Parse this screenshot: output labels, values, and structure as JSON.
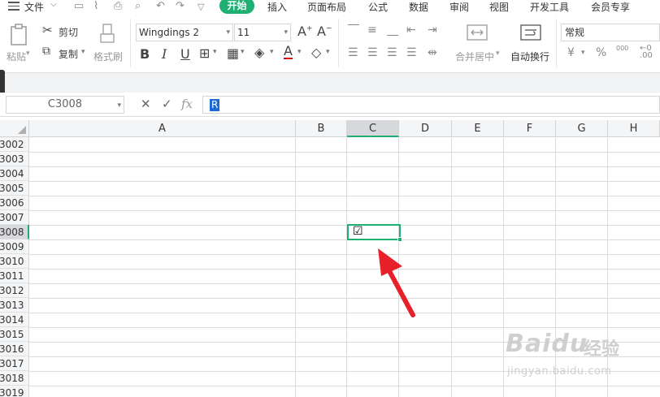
{
  "menu": {
    "file_label": "文件",
    "tabs": [
      "开始",
      "插入",
      "页面布局",
      "公式",
      "数据",
      "审阅",
      "视图",
      "开发工具",
      "会员专享"
    ],
    "active_tab": "开始"
  },
  "ribbon": {
    "paste_label": "粘贴",
    "cut_label": "剪切",
    "copy_label": "复制",
    "format_painter_label": "格式刷",
    "font_name": "Wingdings 2",
    "font_size": "11",
    "bold_label": "B",
    "italic_label": "I",
    "underline_label": "U",
    "font_color_label": "A",
    "merge_center_label": "合并居中",
    "wrap_text_label": "自动换行",
    "number_format": "常规",
    "currency_symbol": "¥",
    "percent_symbol": "%",
    "thousands_label": "000"
  },
  "formula_bar": {
    "name_box": "C3008",
    "cancel_symbol": "✕",
    "confirm_symbol": "✓",
    "fx_label": "fx",
    "content": "R"
  },
  "grid": {
    "columns": [
      "A",
      "B",
      "C",
      "D",
      "E",
      "F",
      "G",
      "H"
    ],
    "selected_column": "C",
    "rows": [
      "3002",
      "3003",
      "3004",
      "3005",
      "3006",
      "3007",
      "3008",
      "3009",
      "3010",
      "3011",
      "3012",
      "3013",
      "3014",
      "3015",
      "3016",
      "3017",
      "3018",
      "3019"
    ],
    "selected_row": "3008",
    "active_cell_value": "☑"
  },
  "colors": {
    "accent": "#1eaf73",
    "arrow": "#e8202a",
    "selection_blue": "#1a6bd8"
  },
  "watermark": {
    "brand": "Baidu",
    "brand_cn": "经验",
    "url": "jingyan.baidu.com"
  }
}
